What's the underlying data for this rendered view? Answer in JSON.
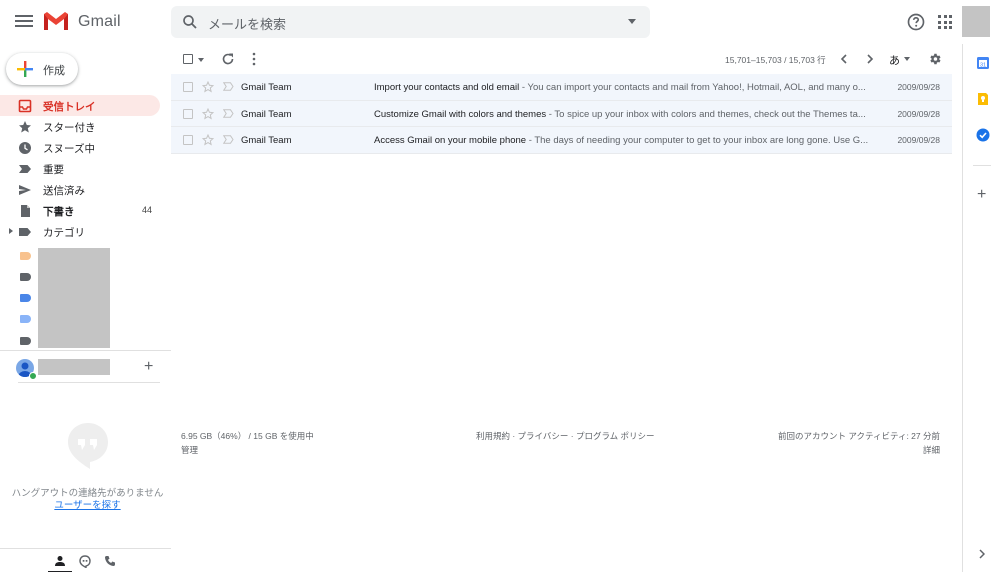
{
  "header": {
    "brand": "Gmail",
    "search_placeholder": "メールを検索"
  },
  "compose": {
    "label": "作成"
  },
  "nav": [
    {
      "label": "受信トレイ",
      "count": "",
      "icon": "inbox-icon"
    },
    {
      "label": "スター付き",
      "count": "",
      "icon": "star-icon"
    },
    {
      "label": "スヌーズ中",
      "count": "",
      "icon": "clock-icon"
    },
    {
      "label": "重要",
      "count": "",
      "icon": "important-icon"
    },
    {
      "label": "送信済み",
      "count": "",
      "icon": "send-icon"
    },
    {
      "label": "下書き",
      "count": "44",
      "icon": "draft-icon"
    },
    {
      "label": "カテゴリ",
      "count": "",
      "icon": "label-icon"
    }
  ],
  "label_colors": [
    "#f8c28e",
    "#5f6368",
    "#4a86e8",
    "#8ab4f8",
    "#5f6368"
  ],
  "hangouts": {
    "no_contacts": "ハングアウトの連絡先がありません",
    "find_users": "ユーザーを探す"
  },
  "toolbar": {
    "pager": "15,701–15,703 / 15,703 行",
    "input_tool": "あ"
  },
  "emails": [
    {
      "sender": "Gmail Team",
      "subject": "Import your contacts and old email",
      "snippet": " - You can import your contacts and mail from Yahoo!, Hotmail, AOL, and many o...",
      "date": "2009/09/28"
    },
    {
      "sender": "Gmail Team",
      "subject": "Customize Gmail with colors and themes",
      "snippet": " - To spice up your inbox with colors and themes, check out the Themes ta...",
      "date": "2009/09/28"
    },
    {
      "sender": "Gmail Team",
      "subject": "Access Gmail on your mobile phone",
      "snippet": " - The days of needing your computer to get to your inbox are long gone. Use G...",
      "date": "2009/09/28"
    }
  ],
  "footer": {
    "storage": "6.95 GB（46%） / 15 GB を使用中",
    "manage": "管理",
    "links": "利用規約 · プライバシー · プログラム ポリシー",
    "activity": "前回のアカウント アクティビティ: 27 分前",
    "details": "詳細"
  },
  "colors": {
    "accent_red": "#d93025",
    "active_bg": "#fce8e6",
    "row_bg": "#f2f6fc"
  }
}
